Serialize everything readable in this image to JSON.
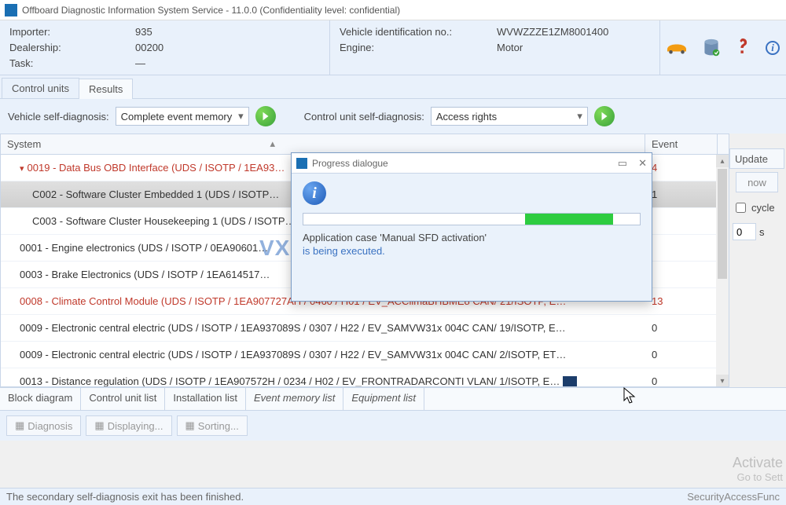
{
  "titlebar": {
    "title": "Offboard Diagnostic Information System Service - 11.0.0 (Confidentiality level: confidential)"
  },
  "info": {
    "left": {
      "importer_label": "Importer:",
      "importer_value": "935",
      "dealership_label": "Dealership:",
      "dealership_value": "00200",
      "task_label": "Task:",
      "task_value": "—"
    },
    "right": {
      "vin_label": "Vehicle identification no.:",
      "vin_value": "WVWZZZE1ZM8001400",
      "engine_label": "Engine:",
      "engine_value": "Motor"
    }
  },
  "tabs": {
    "control_units": "Control units",
    "results": "Results"
  },
  "diag": {
    "vehicle_label": "Vehicle self-diagnosis:",
    "vehicle_select": "Complete event memory",
    "cu_label": "Control unit self-diagnosis:",
    "cu_select": "Access rights"
  },
  "table": {
    "head_system": "System",
    "head_event": "Event",
    "rows": [
      {
        "text": "0019 - Data Bus OBD Interface  (UDS / ISOTP / 1EA93…",
        "event": "4",
        "red": true,
        "expand": true
      },
      {
        "text": "C002 - Software Cluster Embedded 1  (UDS / ISOTP…",
        "event": "1",
        "child": true,
        "selected": true
      },
      {
        "text": "C003 - Software Cluster Housekeeping 1  (UDS / ISOTP…",
        "event": "",
        "child": true
      },
      {
        "text": "0001 - Engine electronics  (UDS / ISOTP / 0EA90601…",
        "event": ""
      },
      {
        "text": "0003 - Brake Electronics  (UDS / ISOTP / 1EA614517…",
        "event": ""
      },
      {
        "text": "0008 - Climate Control Module  (UDS / ISOTP / 1EA907727AH / 0460 / H01 / EV_ACClimaBHBME8 CAN/ 21/ISOTP, E…",
        "event": "13",
        "red": true
      },
      {
        "text": "0009 - Electronic central electric  (UDS / ISOTP / 1EA937089S / 0307 / H22 / EV_SAMVW31x 004C CAN/ 19/ISOTP, E…",
        "event": "0"
      },
      {
        "text": "0009 - Electronic central electric  (UDS / ISOTP / 1EA937089S / 0307 / H22 / EV_SAMVW31x 004C CAN/ 2/ISOTP, ET…",
        "event": "0"
      },
      {
        "text": "0013 - Distance regulation  (UDS / ISOTP / 1EA907572H / 0234 / H02 / EV_FRONTRADARCONTI VLAN/ 1/ISOTP, E…",
        "event": "0",
        "icon": true
      }
    ]
  },
  "right_panel": {
    "head": "Update",
    "now": "now",
    "cycle": "cycle",
    "interval": "0",
    "unit": "s"
  },
  "bottom_tabs": {
    "block_diagram": "Block diagram",
    "control_unit_list": "Control unit list",
    "installation_list": "Installation list",
    "event_memory_list": "Event memory list",
    "equipment_list": "Equipment list"
  },
  "toolbar": {
    "diagnosis": "Diagnosis",
    "displaying": "Displaying...",
    "sorting": "Sorting..."
  },
  "watermark": {
    "activate": "Activate",
    "goto": "Go to Sett",
    "center": "VXDIAGSHOP.COM"
  },
  "statusbar": {
    "left": "The secondary self-diagnosis exit has been finished.",
    "right": "SecurityAccessFunc"
  },
  "dialog": {
    "title": "Progress dialogue",
    "line1": "Application case 'Manual SFD activation'",
    "line2": "is being executed.",
    "progress_left_pct": 66,
    "progress_width_pct": 26
  }
}
